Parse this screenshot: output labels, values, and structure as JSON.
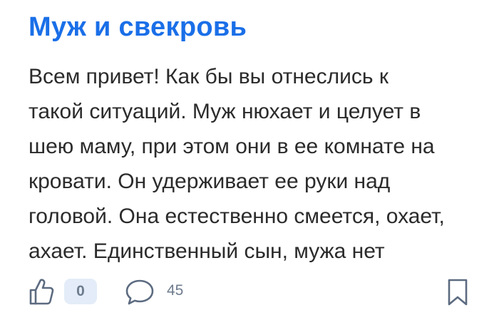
{
  "post": {
    "title": "Муж и свекровь",
    "body_lines": [
      "Всем привет! Как бы вы отнеслись к",
      "такой ситуаций. Муж нюхает и целует в",
      "шею маму, при этом они в ее комнате на",
      "кровати. Он удерживает ее руки над",
      "головой. Она естественно смеется, охает,",
      "ахает. Единственный сын, мужа нет"
    ]
  },
  "actions": {
    "like_icon": "thumbs-up-icon",
    "like_count": "0",
    "comment_icon": "comment-bubble-icon",
    "comment_count": "45",
    "bookmark_icon": "bookmark-icon"
  },
  "colors": {
    "title": "#1a6fe8",
    "text": "#2b2b2b",
    "icon": "#5c6b80",
    "badge_bg": "#e3ecf8"
  }
}
